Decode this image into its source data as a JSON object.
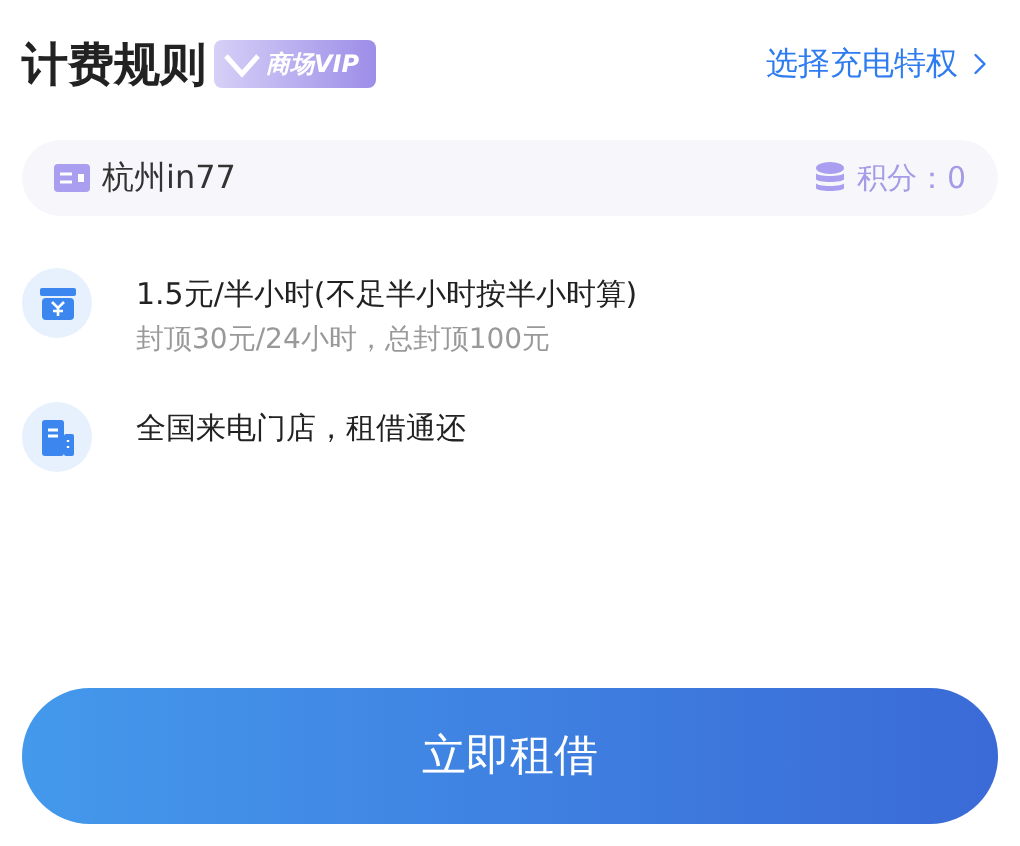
{
  "header": {
    "title": "计费规则",
    "badge": "商场VIP",
    "link": "选择充电特权"
  },
  "store": {
    "name": "杭州in77",
    "points_label": "积分：",
    "points": "0"
  },
  "rules": [
    {
      "kind": "price",
      "text": "1.5元/半小时(不足半小时按半小时算)",
      "subtext": "封顶30元/24小时，总封顶100元"
    },
    {
      "kind": "store",
      "text": "全国来电门店，租借通还"
    }
  ],
  "action": {
    "label": "立即租借"
  }
}
